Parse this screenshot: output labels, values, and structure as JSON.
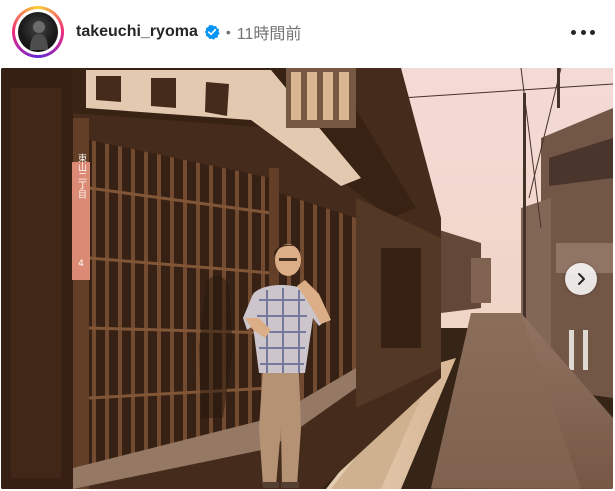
{
  "post": {
    "username": "takeuchi_ryoma",
    "separator": "•",
    "timestamp": "11時間前",
    "verified": true
  },
  "photo": {
    "sign_text": "東山二丁目 4"
  },
  "icons": {
    "more": "more-horizontal-icon",
    "verified": "verified-badge-icon",
    "next": "chevron-right-icon"
  },
  "colors": {
    "verified_blue": "#0095f6",
    "username": "#262626",
    "muted": "#737373"
  }
}
